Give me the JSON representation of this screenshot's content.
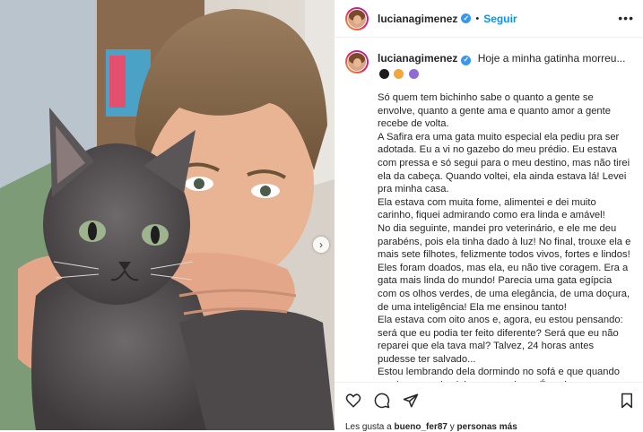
{
  "header": {
    "username": "lucianagimenez",
    "follow_label": "Seguir",
    "separator": "•",
    "more_glyph": "•••"
  },
  "caption": {
    "username": "lucianagimenez",
    "title": "Hoje a minha gatinha morreu...",
    "emojis": [
      "black-heart",
      "crying-cat",
      "cat-face"
    ],
    "paragraphs": [
      "Só quem tem bichinho sabe o quanto a gente se envolve, quanto a gente ama e quanto amor a gente recebe de volta.",
      "A Safira era uma gata muito especial ela pediu pra ser adotada. Eu a vi no gazebo do meu prédio. Eu estava com pressa e só segui para o meu destino, mas não tirei ela da cabeça. Quando voltei, ela ainda estava lá! Levei pra minha casa.",
      "Ela estava com muita fome, alimentei e dei muito carinho, fiquei admirando como era linda e amável!",
      "No dia seguinte, mandei pro veterinário, e ele me deu parabéns, pois ela tinha dado à luz! No final, trouxe ela e mais sete filhotes, felizmente todos vivos, fortes e lindos!",
      "Eles foram doados, mas ela, eu não tive coragem. Era a gata mais linda do mundo! Parecia uma gata egípcia com os olhos verdes, de uma elegância, de uma doçura, de uma inteligência! Ela me ensinou tanto!",
      "Ela estava com oito anos e, agora, eu estou pensando: será que eu podia ter feito diferente? Será que eu não reparei que ela tava mal? Talvez, 24 horas antes pudesse ter salvado...",
      "Estou lembrando dela dormindo no sofá e que quando eu chegava, ela vinha me receber... É assim que vou sempre lembrar da minha gatinha! Ela se foi hoje, e eu estou aqui com o buraquinho dela no sofá morrendo de saudades, chorando sozinha e pensando que eu podia ter tido um pouquinho mais"
    ]
  },
  "likes": {
    "prefix": "Les gusta a",
    "user": "bueno_fer87",
    "connector": "y",
    "others": "personas más"
  },
  "icons": [
    "heart-icon",
    "comment-icon",
    "share-icon",
    "save-icon",
    "verified-icon",
    "chevron-right-icon"
  ],
  "colors": {
    "accent": "#0095f6",
    "verified": "#3897f0",
    "text": "#262626"
  }
}
